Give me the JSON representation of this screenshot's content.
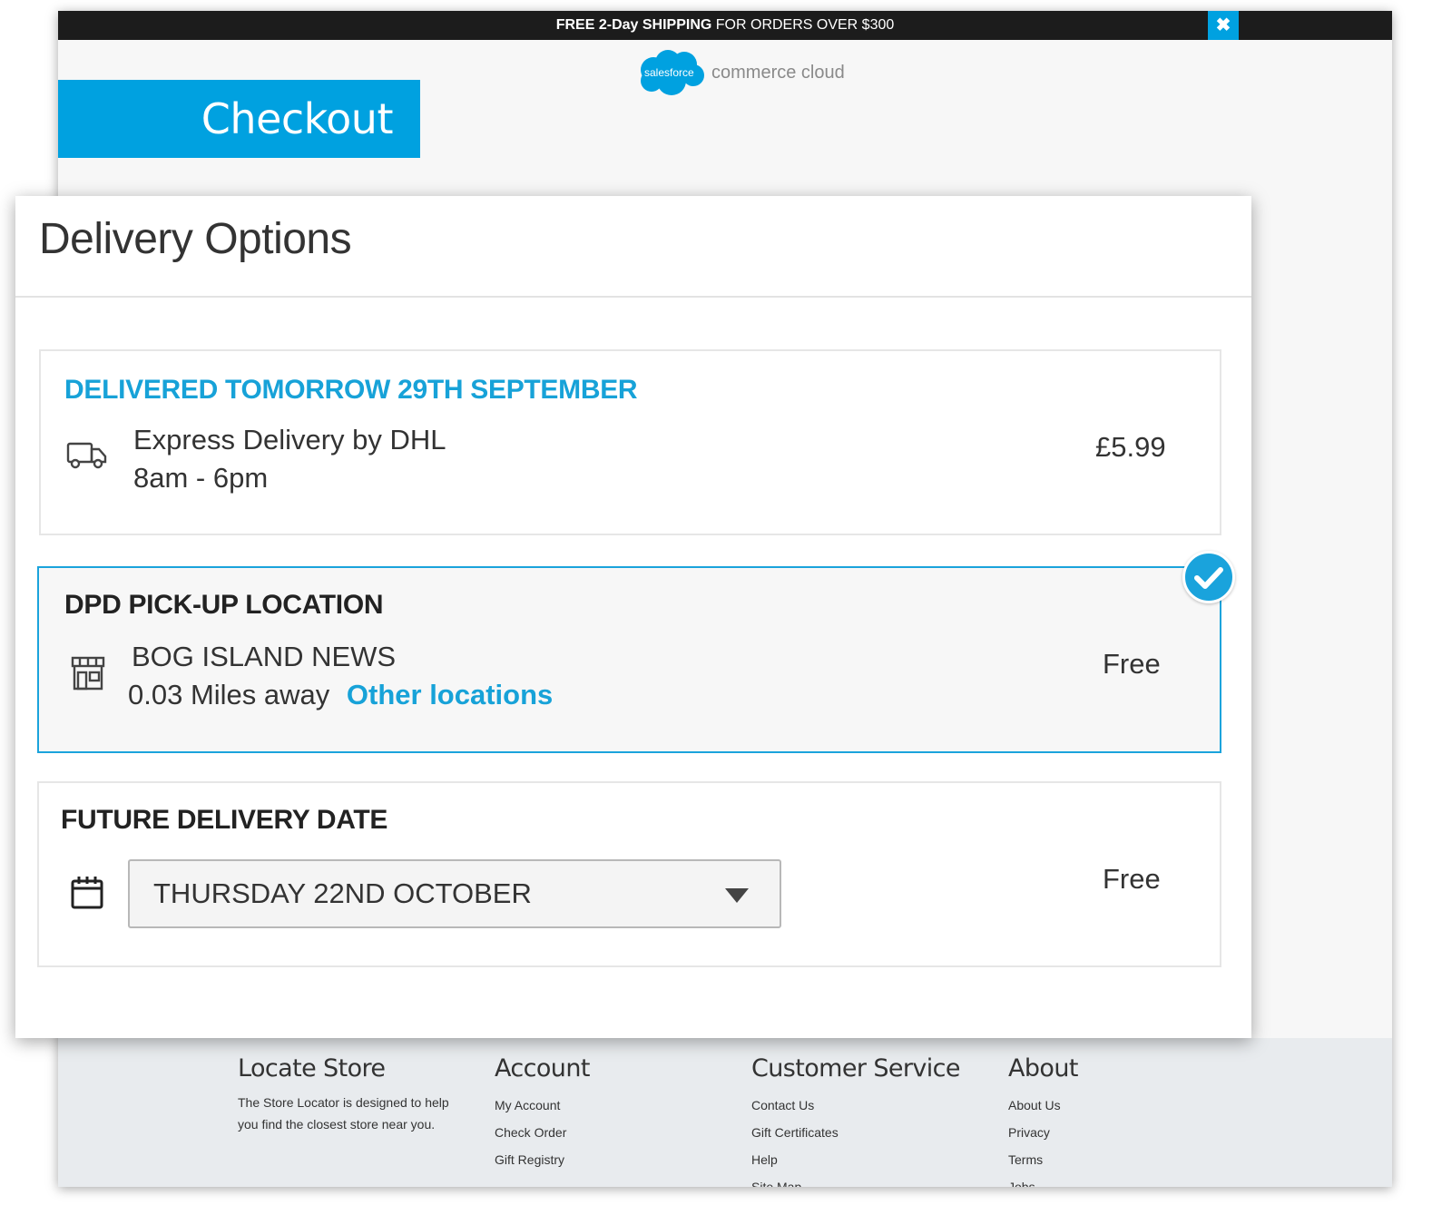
{
  "promo": {
    "bold": "FREE 2-Day SHIPPING",
    "rest": " FOR ORDERS OVER $300",
    "close_icon": "close-icon"
  },
  "logo": {
    "cloud_text": "salesforce",
    "text": "commerce cloud"
  },
  "checkout": {
    "label": "Checkout"
  },
  "modal": {
    "title": "Delivery Options",
    "options": [
      {
        "heading": "DELIVERED TOMORROW 29TH SEPTEMBER",
        "line1": "Express Delivery by DHL",
        "line2": "8am - 6pm",
        "price": "£5.99",
        "icon": "truck-icon"
      },
      {
        "heading": "DPD PICK-UP LOCATION",
        "line1": "BOG ISLAND NEWS",
        "line2": "0.03 Miles away",
        "link": "Other locations",
        "price": "Free",
        "icon": "store-icon",
        "selected": true
      },
      {
        "heading": "FUTURE DELIVERY DATE",
        "selected_date": "THURSDAY 22ND OCTOBER",
        "price": "Free",
        "icon": "calendar-icon"
      }
    ]
  },
  "footer": {
    "locate": {
      "title": "Locate Store",
      "text": "The Store Locator is designed to help you find the closest store near you."
    },
    "account": {
      "title": "Account",
      "links": [
        "My Account",
        "Check Order",
        "Gift Registry"
      ]
    },
    "service": {
      "title": "Customer Service",
      "links": [
        "Contact Us",
        "Gift Certificates",
        "Help",
        "Site Map"
      ]
    },
    "about": {
      "title": "About",
      "links": [
        "About Us",
        "Privacy",
        "Terms",
        "Jobs"
      ]
    }
  },
  "colors": {
    "accent": "#00a1e0",
    "promo_bg": "#1c1c1c",
    "footer_bg": "#e8ebee"
  }
}
